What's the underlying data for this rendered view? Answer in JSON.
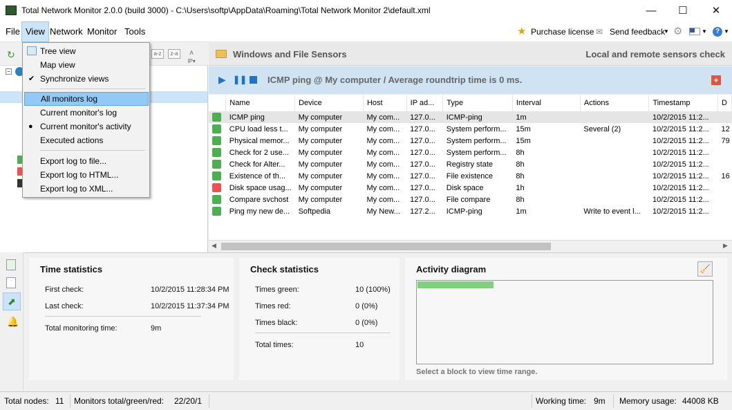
{
  "window": {
    "title": "Total Network Monitor 2.0.0 (build 3000) - C:\\Users\\softp\\AppData\\Roaming\\Total Network Monitor 2\\default.xml",
    "minimize": "—",
    "maximize": "☐",
    "close": "✕"
  },
  "menubar": {
    "items": [
      "File",
      "View",
      "Network",
      "Monitor",
      "Tools"
    ],
    "purchase": "Purchase license",
    "feedback": "Send feedback",
    "help_icon": "question-icon"
  },
  "view_menu": {
    "items": [
      {
        "label": "Tree view",
        "mark": ""
      },
      {
        "label": "Map view",
        "mark": ""
      },
      {
        "label": "Synchronize views",
        "mark": "✔"
      },
      {
        "label": "All monitors log",
        "mark": ""
      },
      {
        "label": "Current monitor's log",
        "mark": ""
      },
      {
        "label": "Current monitor's activity",
        "mark": "●"
      },
      {
        "label": "Executed actions",
        "mark": ""
      },
      {
        "label": "Export log to file...",
        "mark": ""
      },
      {
        "label": "Export log to HTML...",
        "mark": ""
      },
      {
        "label": "Export log to XML...",
        "mark": ""
      }
    ]
  },
  "sensor_header": {
    "title": "Windows and File Sensors",
    "subtitle": "Local and remote sensors check"
  },
  "monitor_bar": {
    "text": "ICMP ping @ My computer /  Average roundtrip time is 0 ms."
  },
  "table": {
    "columns": [
      "Name",
      "Device",
      "Host",
      "IP ad...",
      "Type",
      "Interval",
      "Actions",
      "Timestamp",
      "D"
    ],
    "rows": [
      {
        "status": "#4caf50",
        "name": "ICMP ping",
        "device": "My computer",
        "host": "My com...",
        "ip": "127.0...",
        "type": "ICMP-ping",
        "interval": "1m",
        "actions": "",
        "timestamp": "10/2/2015 11:2...",
        "d": ""
      },
      {
        "status": "#4caf50",
        "name": "CPU load less t...",
        "device": "My computer",
        "host": "My com...",
        "ip": "127.0...",
        "type": "System perform...",
        "interval": "15m",
        "actions": "Several (2)",
        "timestamp": "10/2/2015 11:2...",
        "d": "12"
      },
      {
        "status": "#4caf50",
        "name": "Physical memor...",
        "device": "My computer",
        "host": "My com...",
        "ip": "127.0...",
        "type": "System perform...",
        "interval": "15m",
        "actions": "",
        "timestamp": "10/2/2015 11:2...",
        "d": "79"
      },
      {
        "status": "#4caf50",
        "name": "Check for 2 use...",
        "device": "My computer",
        "host": "My com...",
        "ip": "127.0...",
        "type": "System perform...",
        "interval": "8h",
        "actions": "",
        "timestamp": "10/2/2015 11:2...",
        "d": ""
      },
      {
        "status": "#4caf50",
        "name": "Check for Alter...",
        "device": "My computer",
        "host": "My com...",
        "ip": "127.0...",
        "type": "Registry state",
        "interval": "8h",
        "actions": "",
        "timestamp": "10/2/2015 11:2...",
        "d": ""
      },
      {
        "status": "#4caf50",
        "name": "Existence of th...",
        "device": "My computer",
        "host": "My com...",
        "ip": "127.0...",
        "type": "File existence",
        "interval": "8h",
        "actions": "",
        "timestamp": "10/2/2015 11:2...",
        "d": "16"
      },
      {
        "status": "#f05050",
        "name": "Disk space usag...",
        "device": "My computer",
        "host": "My com...",
        "ip": "127.0...",
        "type": "Disk space",
        "interval": "1h",
        "actions": "",
        "timestamp": "10/2/2015 11:2...",
        "d": ""
      },
      {
        "status": "#4caf50",
        "name": "Compare svchost",
        "device": "My computer",
        "host": "My com...",
        "ip": "127.0...",
        "type": "File compare",
        "interval": "8h",
        "actions": "",
        "timestamp": "10/2/2015 11:2...",
        "d": ""
      },
      {
        "status": "#4caf50",
        "name": "Ping my new de...",
        "device": "Softpedia",
        "host": "My New...",
        "ip": "127.2...",
        "type": "ICMP-ping",
        "interval": "1m",
        "actions": "Write to event l...",
        "timestamp": "10/2/2015 11:2...",
        "d": ""
      }
    ]
  },
  "time_stats": {
    "title": "Time statistics",
    "first_label": "First check:",
    "first_value": "10/2/2015 11:28:34 PM",
    "last_label": "Last check:",
    "last_value": "10/2/2015 11:37:34 PM",
    "total_label": "Total monitoring time:",
    "total_value": "9m"
  },
  "check_stats": {
    "title": "Check statistics",
    "green_label": "Times green:",
    "green_value": "10 (100%)",
    "red_label": "Times red:",
    "red_value": "0 (0%)",
    "black_label": "Times black:",
    "black_value": "0 (0%)",
    "total_label": "Total times:",
    "total_value": "10"
  },
  "activity": {
    "title": "Activity diagram",
    "hint": "Select a block to view time range.",
    "bar_color": "#7fd07f"
  },
  "statusbar": {
    "nodes_label": "Total nodes:",
    "nodes_value": "11",
    "monitors_label": "Monitors total/green/red:",
    "monitors_value": "22/20/1",
    "working_label": "Working time:",
    "working_value": "9m",
    "memory_label": "Memory usage:",
    "memory_value": "44008 KB"
  },
  "colors": {
    "green": "#4caf50",
    "red": "#f05050",
    "black": "#333333",
    "accent": "#91c9f7"
  }
}
